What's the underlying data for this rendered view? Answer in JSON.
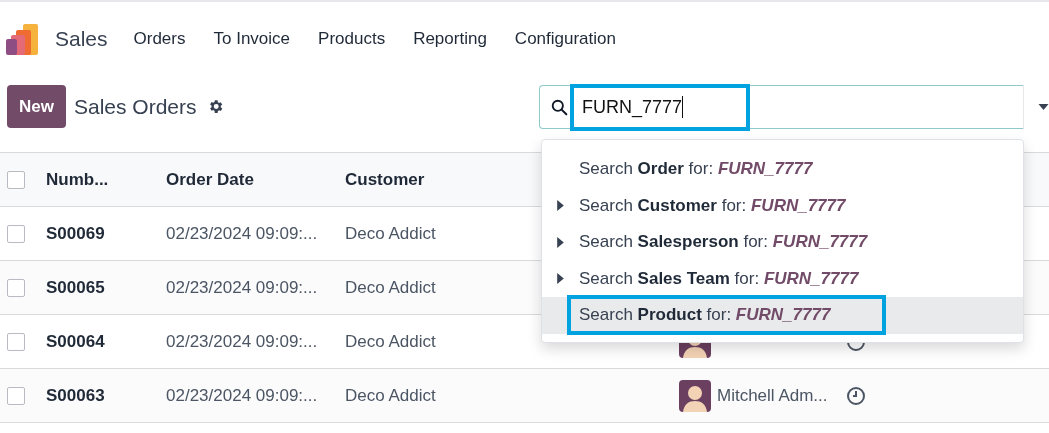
{
  "app": {
    "name": "Sales"
  },
  "menu": [
    "Orders",
    "To Invoice",
    "Products",
    "Reporting",
    "Configuration"
  ],
  "control_panel": {
    "new_button": "New",
    "title": "Sales Orders"
  },
  "search": {
    "value": "FURN_7777",
    "outlined": true
  },
  "suggestions": [
    {
      "prefix": "Search",
      "field": "Order",
      "suffix": "for:",
      "value": "FURN_7777",
      "expandable": false,
      "selected": false,
      "outlined": false
    },
    {
      "prefix": "Search",
      "field": "Customer",
      "suffix": "for:",
      "value": "FURN_7777",
      "expandable": true,
      "selected": false,
      "outlined": false
    },
    {
      "prefix": "Search",
      "field": "Salesperson",
      "suffix": "for:",
      "value": "FURN_7777",
      "expandable": true,
      "selected": false,
      "outlined": false
    },
    {
      "prefix": "Search",
      "field": "Sales Team",
      "suffix": "for:",
      "value": "FURN_7777",
      "expandable": true,
      "selected": false,
      "outlined": false
    },
    {
      "prefix": "Search",
      "field": "Product",
      "suffix": "for:",
      "value": "FURN_7777",
      "expandable": false,
      "selected": true,
      "outlined": true
    }
  ],
  "table": {
    "all_checked": false,
    "columns": [
      "Numb...",
      "Order Date",
      "Customer"
    ],
    "rows": [
      {
        "number": "S00069",
        "order_date": "02/23/2024 09:09:...",
        "customer": "Deco Addict",
        "checked": false
      },
      {
        "number": "S00065",
        "order_date": "02/23/2024 09:09:...",
        "customer": "Deco Addict",
        "checked": false
      },
      {
        "number": "S00064",
        "order_date": "02/23/2024 09:09:...",
        "customer": "Deco Addict",
        "checked": false,
        "assigned": true
      },
      {
        "number": "S00063",
        "order_date": "02/23/2024 09:09:...",
        "customer": "Deco Addict",
        "checked": false,
        "assigned": true,
        "salesperson": "Mitchell Adm..."
      }
    ]
  }
}
